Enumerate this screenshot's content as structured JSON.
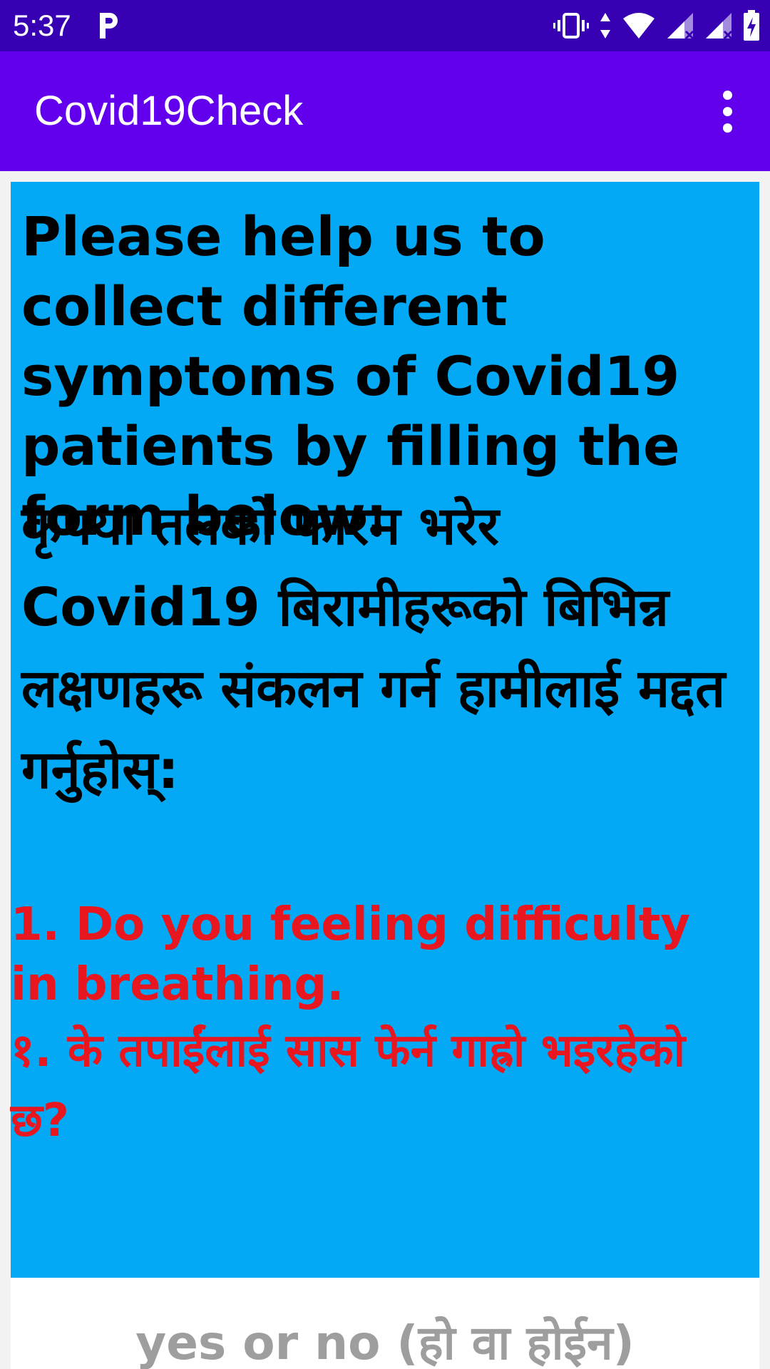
{
  "status_bar": {
    "time": "5:37",
    "icons": [
      "parking-icon",
      "vibrate-icon",
      "data-arrows-icon",
      "wifi-icon",
      "signal-icon",
      "signal-icon",
      "battery-charging-icon"
    ]
  },
  "app_bar": {
    "title": "Covid19Check",
    "menu_icon": "more-vert-icon"
  },
  "content": {
    "intro_en": "Please help us to collect different symptoms of Covid19 patients by filling the form below:",
    "intro_ne": "कृपया तलको फारम भरेर Covid19  बिरामीहरूको बिभिन्न लक्षणहरू संकलन गर्न हामीलाई मद्दत गर्नुहोस्:",
    "question_en": "1. Do you feeling difficulty in breathing.",
    "question_ne": "१. के तपाईंलाई सास फेर्न गाह्रो भइरहेको छ?"
  },
  "answer": {
    "placeholder": "yes or no (हो वा होईन)"
  },
  "colors": {
    "status_bar": "#3700b3",
    "app_bar": "#6200ee",
    "card": "#03a9f4",
    "question_text": "#e8171f",
    "placeholder_text": "#9e9e9e"
  }
}
